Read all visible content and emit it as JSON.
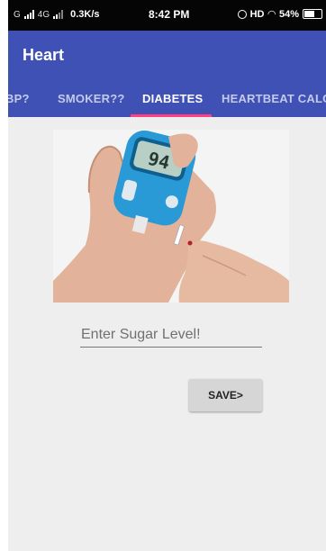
{
  "status_bar": {
    "carrier": "G",
    "network": "4G",
    "net_speed": "0.3K/s",
    "time": "8:42 PM",
    "hd_label": "HD",
    "battery": "54%"
  },
  "app_bar": {
    "title": "Heart",
    "tabs": [
      {
        "label": "BP?",
        "active": false
      },
      {
        "label": "SMOKER??",
        "active": false
      },
      {
        "label": "DIABETES",
        "active": true
      },
      {
        "label": "HEARTBEAT CALC",
        "active": false
      }
    ]
  },
  "colors": {
    "primary": "#3f51b5",
    "accent": "#ff4081",
    "background": "#eeeeee",
    "meter_body": "#2a9ad6"
  },
  "hero": {
    "meter_reading": "94"
  },
  "form": {
    "sugar_placeholder": "Enter Sugar Level!",
    "sugar_value": "",
    "save_label": "SAVE>"
  }
}
